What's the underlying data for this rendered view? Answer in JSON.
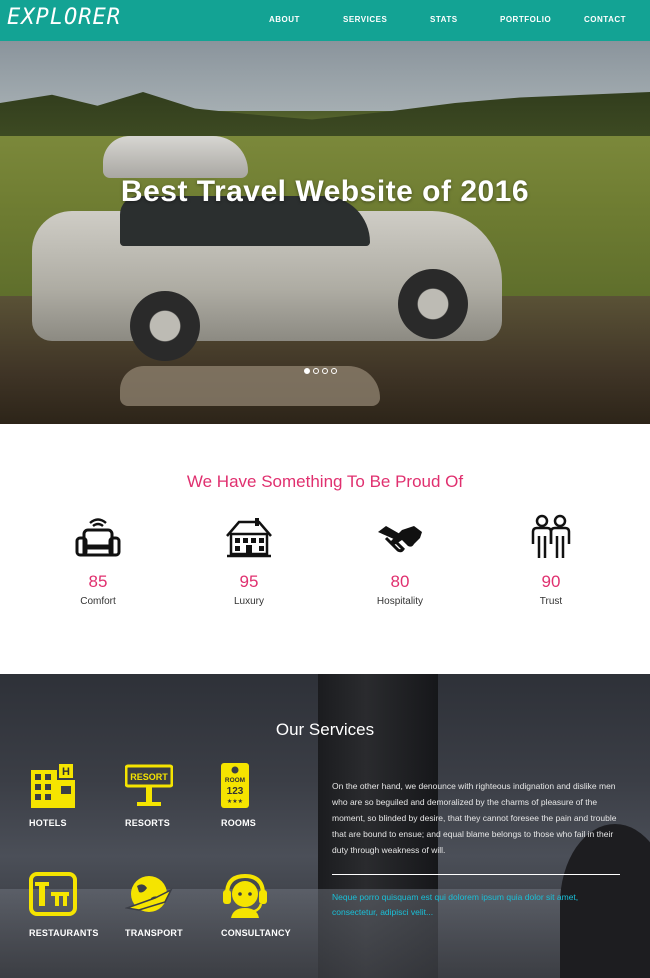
{
  "brand": "EXPLORER",
  "colors": {
    "nav": "#13a394",
    "accent": "#e0306f",
    "service_icon": "#f5e400",
    "quote": "#19c0d8"
  },
  "nav": {
    "items": [
      "ABOUT",
      "SERVICES",
      "STATS",
      "PORTFOLIO",
      "CONTACT"
    ]
  },
  "hero": {
    "title": "Best Travel Website of 2016",
    "slides": 4,
    "active_slide": 1
  },
  "proud": {
    "title": "We Have Something To Be Proud Of",
    "stats": [
      {
        "icon": "armchair-icon",
        "value": "85",
        "label": "Comfort"
      },
      {
        "icon": "house-icon",
        "value": "95",
        "label": "Luxury"
      },
      {
        "icon": "handshake-icon",
        "value": "80",
        "label": "Hospitality"
      },
      {
        "icon": "people-icon",
        "value": "90",
        "label": "Trust"
      }
    ]
  },
  "services": {
    "title": "Our Services",
    "items": [
      {
        "icon": "hotel-icon",
        "label": "HOTELS"
      },
      {
        "icon": "resort-sign-icon",
        "label": "RESORTS",
        "sign_text": "RESORT"
      },
      {
        "icon": "room-tag-icon",
        "label": "ROOMS",
        "tag_text": "ROOM",
        "tag_number": "123"
      },
      {
        "icon": "restaurant-icon",
        "label": "RESTAURANTS"
      },
      {
        "icon": "globe-plane-icon",
        "label": "TRANSPORT"
      },
      {
        "icon": "headset-icon",
        "label": "CONSULTANCY"
      }
    ],
    "paragraph": "On the other hand, we denounce with righteous indignation and dislike men who are so beguiled and demoralized by the charms of pleasure of the moment, so blinded by desire, that they cannot foresee the pain and trouble that are bound to ensue; and equal blame belongs to those who fail in their duty through weakness of will.",
    "quote": "Neque porro quisquam est qui dolorem ipsum quia dolor sit amet, consectetur, adipisci velit..."
  }
}
